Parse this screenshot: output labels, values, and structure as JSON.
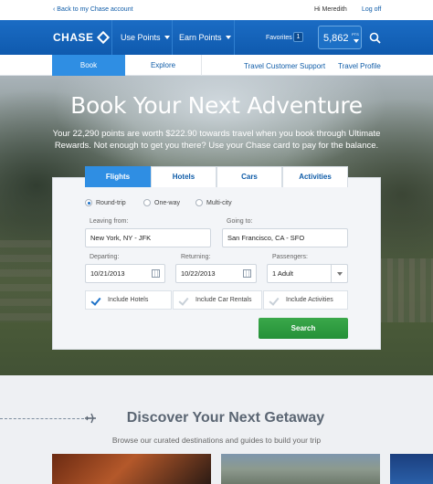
{
  "topbar": {
    "back_link": "‹ Back to my Chase account",
    "greeting": "Hi Meredith",
    "logout": "Log off"
  },
  "nav": {
    "logo": "CHASE",
    "use_points": "Use Points",
    "earn_points": "Earn Points",
    "favorites": "Favorites",
    "favorites_count": "1",
    "points_balance": "5,862",
    "points_unit": "PTS"
  },
  "subnav": {
    "book": "Book",
    "explore": "Explore",
    "customer_support": "Travel Customer Support",
    "profile": "Travel Profile"
  },
  "hero": {
    "title": "Book Your Next Adventure",
    "subtitle": "Your 22,290 points are worth $222.90 towards travel when you book through Ultimate Rewards. Not enough to get you there? Use your Chase card to pay for the balance."
  },
  "booking": {
    "tabs": [
      "Flights",
      "Hotels",
      "Cars",
      "Activities"
    ],
    "active_tab": "Flights",
    "trip_types": [
      "Round-trip",
      "One-way",
      "Multi-city"
    ],
    "selected_trip_type": "Round-trip",
    "leaving_label": "Leaving from:",
    "leaving_value": "New York, NY - JFK",
    "going_label": "Going to:",
    "going_value": "San Francisco, CA - SFO",
    "departing_label": "Departing:",
    "departing_value": "10/21/2013",
    "returning_label": "Returning:",
    "returning_value": "10/22/2013",
    "passengers_label": "Passengers:",
    "passengers_value": "1 Adult",
    "include_hotels": "Include Hotels",
    "include_car_rentals": "Include Car Rentals",
    "include_activities": "Include Activities",
    "include_hotels_checked": true,
    "search_button": "Search"
  },
  "discover": {
    "title": "Discover Your Next Getaway",
    "subtitle": "Browse our curated destinations and guides to build your trip"
  },
  "colors": {
    "brand_blue": "#1b6cc4",
    "accent_blue": "#2f8ee3",
    "search_green": "#2e9b3f"
  }
}
